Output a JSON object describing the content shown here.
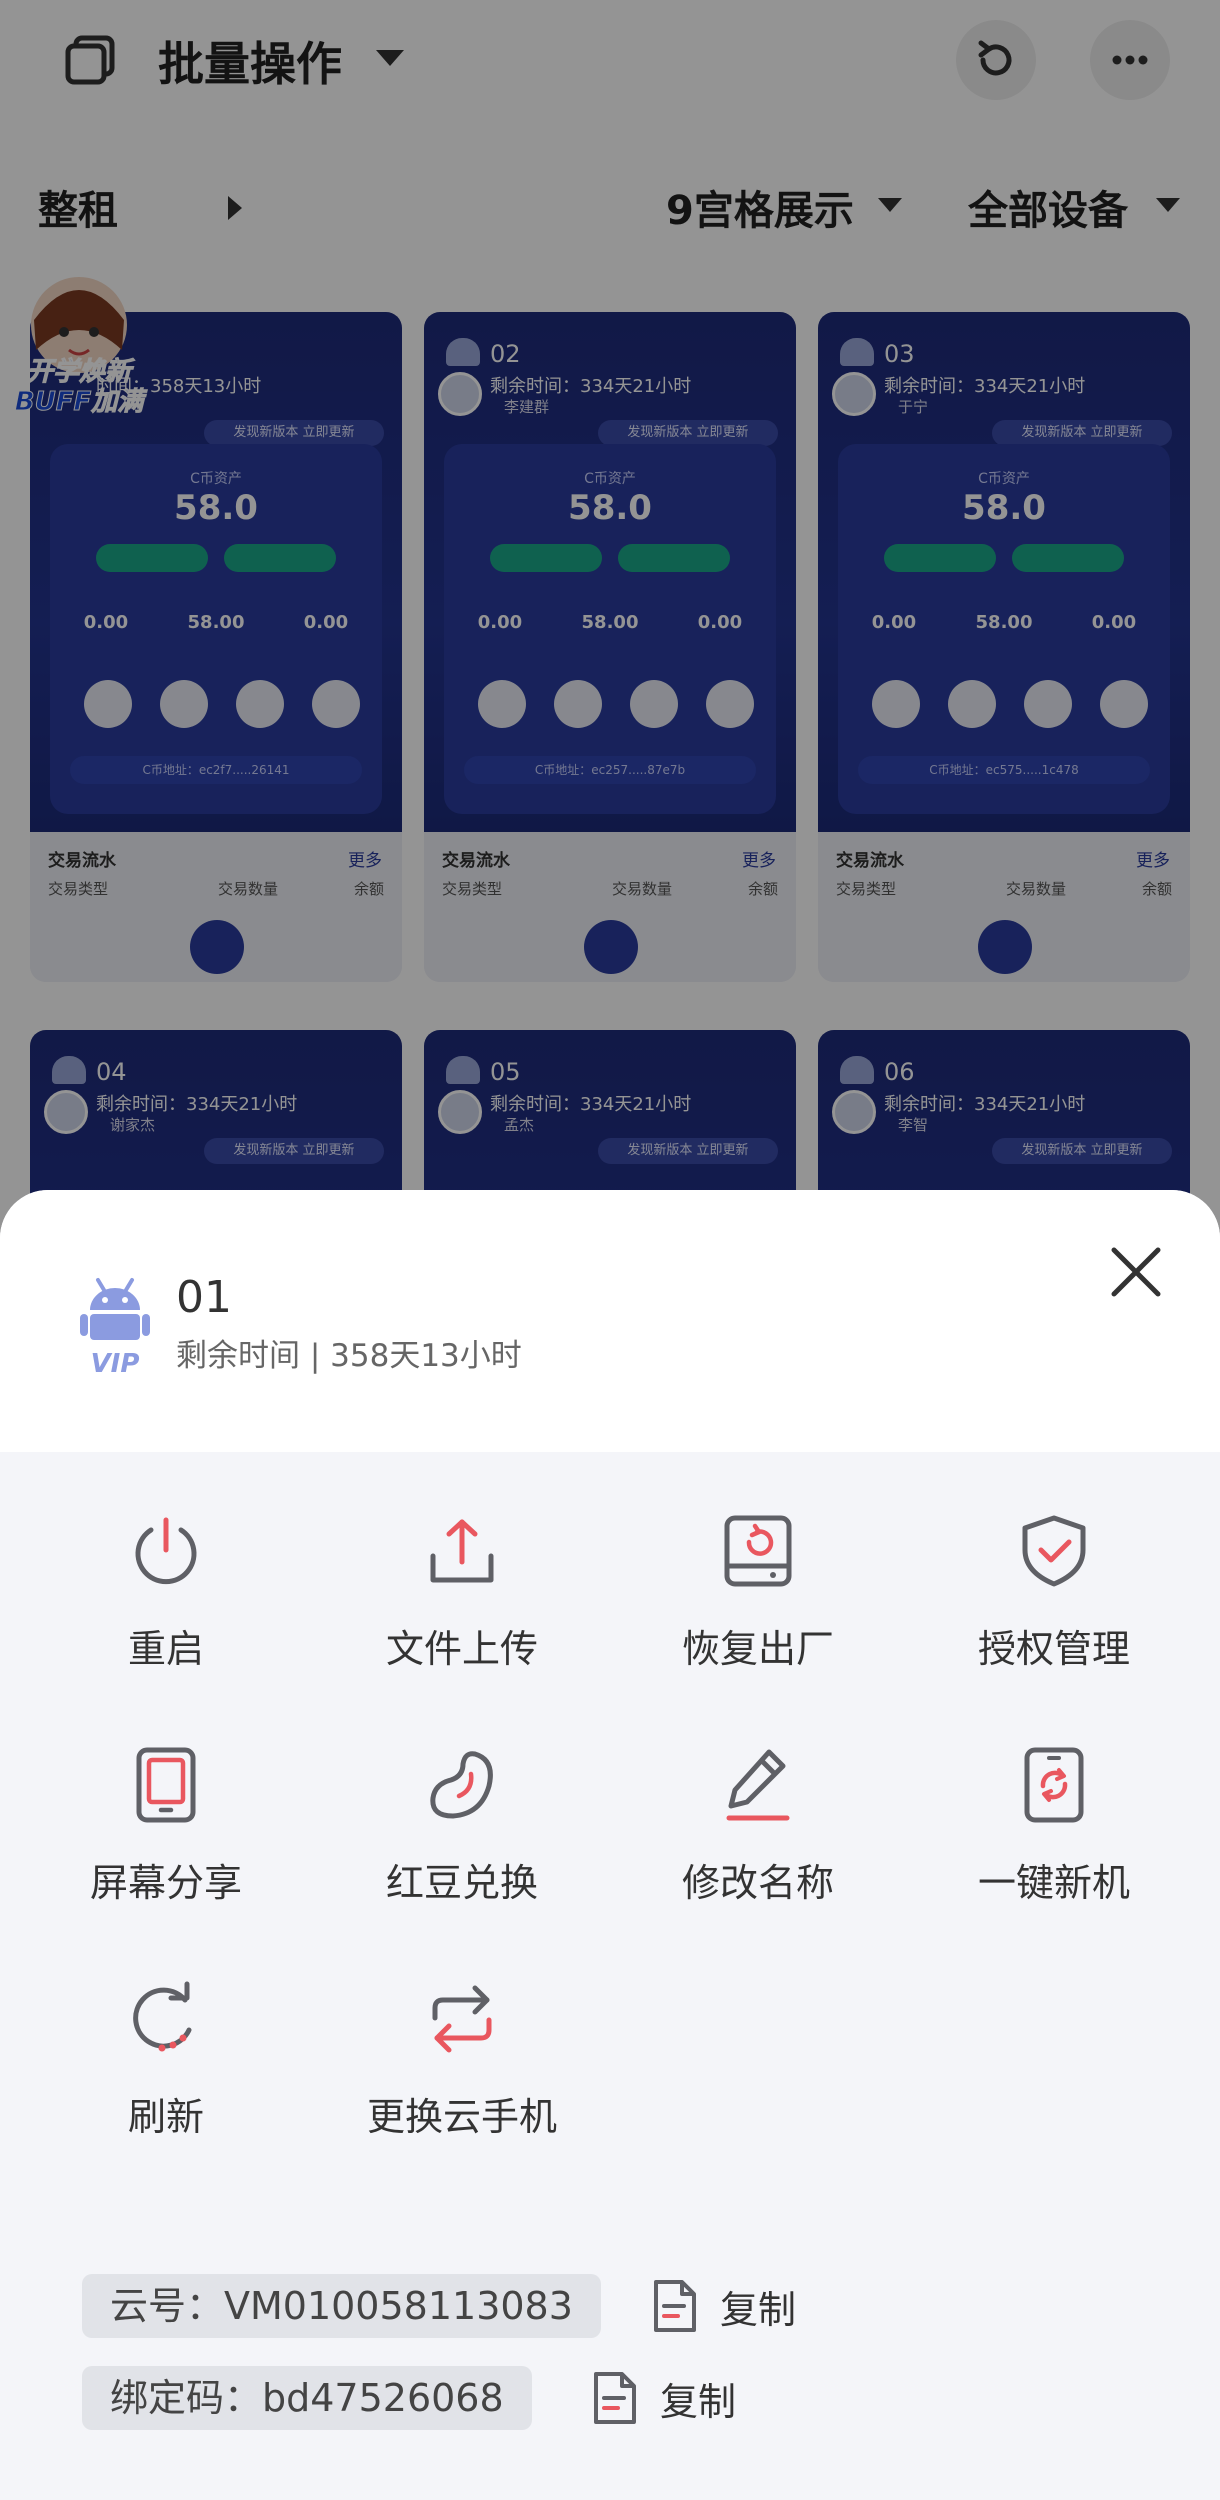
{
  "topbar": {
    "title": "批量操作",
    "icons": [
      "copy-stack-icon",
      "chevron-down-icon",
      "refresh-icon",
      "more-icon"
    ]
  },
  "filters": {
    "rent": "整租",
    "layout": "9宫格展示",
    "devices": "全部设备"
  },
  "badge": {
    "line1": "开学焕新",
    "line2": "BUFF加满"
  },
  "tiles": [
    {
      "number": "",
      "remaining": "时间：358天13小时",
      "owner": "",
      "asset_label": "C币资产",
      "asset": "58.0",
      "stats": [
        "0.00",
        "58.00",
        "0.00"
      ],
      "update": "发现新版本 立即更新",
      "address": "C币地址：ec2f7.....26141",
      "tx_title": "交易流水",
      "tx_more": "更多",
      "tx_cols": [
        "交易类型",
        "交易数量",
        "余额"
      ]
    },
    {
      "number": "02",
      "remaining": "剩余时间：334天21小时",
      "owner": "李建群",
      "asset_label": "C币资产",
      "asset": "58.0",
      "stats": [
        "0.00",
        "58.00",
        "0.00"
      ],
      "update": "发现新版本 立即更新",
      "address": "C币地址：ec257.....87e7b",
      "tx_title": "交易流水",
      "tx_more": "更多",
      "tx_cols": [
        "交易类型",
        "交易数量",
        "余额"
      ]
    },
    {
      "number": "03",
      "remaining": "剩余时间：334天21小时",
      "owner": "于宁",
      "asset_label": "C币资产",
      "asset": "58.0",
      "stats": [
        "0.00",
        "58.00",
        "0.00"
      ],
      "update": "发现新版本 立即更新",
      "address": "C币地址：ec575.....1c478",
      "tx_title": "交易流水",
      "tx_more": "更多",
      "tx_cols": [
        "交易类型",
        "交易数量",
        "余额"
      ]
    },
    {
      "number": "04",
      "remaining": "剩余时间：334天21小时",
      "owner": "谢家杰",
      "update": "发现新版本 立即更新"
    },
    {
      "number": "05",
      "remaining": "剩余时间：334天21小时",
      "owner": "孟杰",
      "update": "发现新版本 立即更新"
    },
    {
      "number": "06",
      "remaining": "剩余时间：334天21小时",
      "owner": "李智",
      "update": "发现新版本 立即更新"
    }
  ],
  "sheet": {
    "device_name": "01",
    "remaining": "剩余时间 | 358天13小时",
    "actions": [
      {
        "label": "重启",
        "icon": "power-icon"
      },
      {
        "label": "文件上传",
        "icon": "upload-icon"
      },
      {
        "label": "恢复出厂",
        "icon": "factory-reset-icon"
      },
      {
        "label": "授权管理",
        "icon": "shield-check-icon"
      },
      {
        "label": "屏幕分享",
        "icon": "screen-share-icon"
      },
      {
        "label": "红豆兑换",
        "icon": "red-bean-icon"
      },
      {
        "label": "修改名称",
        "icon": "pencil-icon"
      },
      {
        "label": "一键新机",
        "icon": "phone-refresh-icon"
      },
      {
        "label": "刷新",
        "icon": "refresh-icon"
      },
      {
        "label": "更换云手机",
        "icon": "swap-icon"
      }
    ],
    "cloud_id": "云号：VM010058113083",
    "bind_code": "绑定码：bd47526068",
    "copy_label": "复制"
  },
  "colors": {
    "accent_red": "#e9575f",
    "icon_gray": "#5f6066",
    "tile_blue": "#23348f",
    "chip_bg": "#e1e3e8",
    "android_blue": "#8b9be0"
  }
}
